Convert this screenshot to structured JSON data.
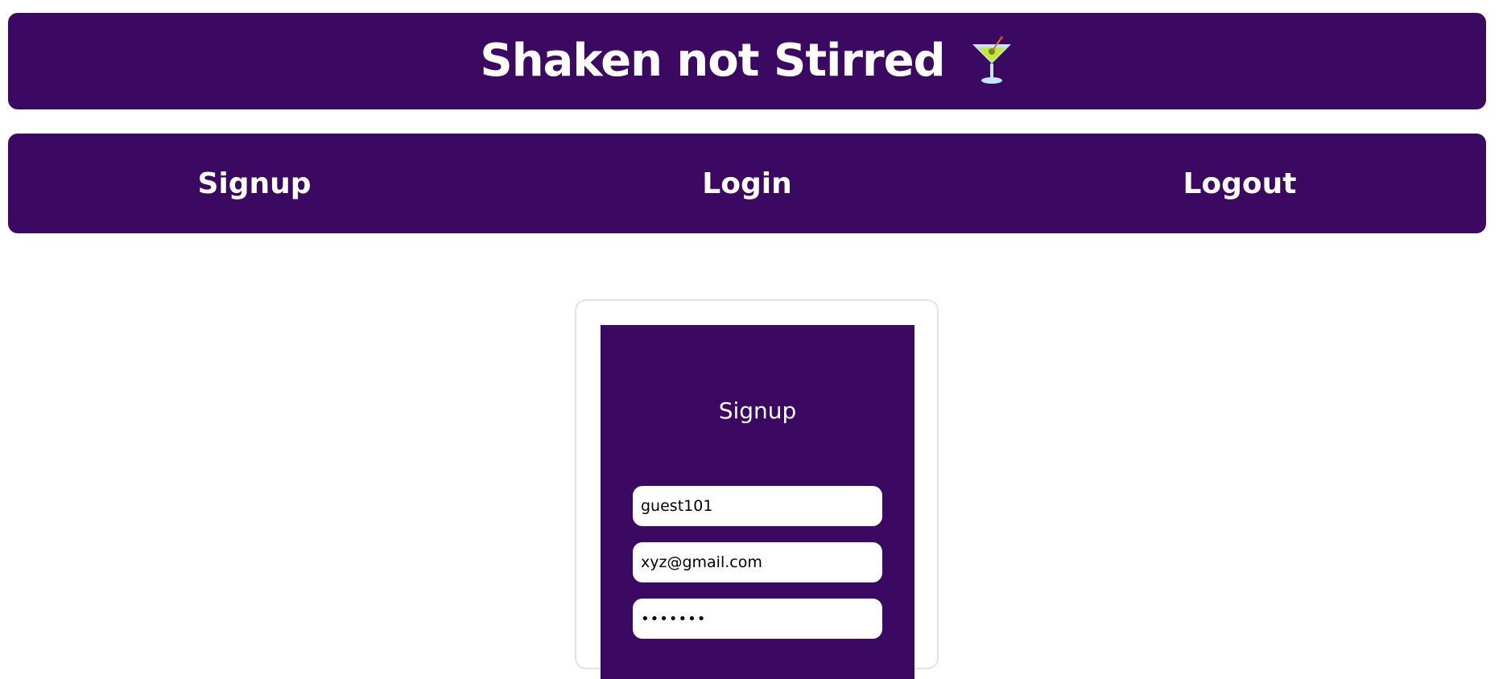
{
  "header": {
    "title": "Shaken not Stirred",
    "icon": "cocktail-icon"
  },
  "nav": {
    "items": [
      {
        "label": "Signup"
      },
      {
        "label": "Login"
      },
      {
        "label": "Logout"
      }
    ]
  },
  "signup_form": {
    "title": "Signup",
    "username_value": "guest101",
    "email_value": "xyz@gmail.com",
    "password_value": "•••••••"
  },
  "colors": {
    "primary": "#3b0862",
    "text_light": "#ffffff",
    "card_border": "#e3e3e3"
  }
}
